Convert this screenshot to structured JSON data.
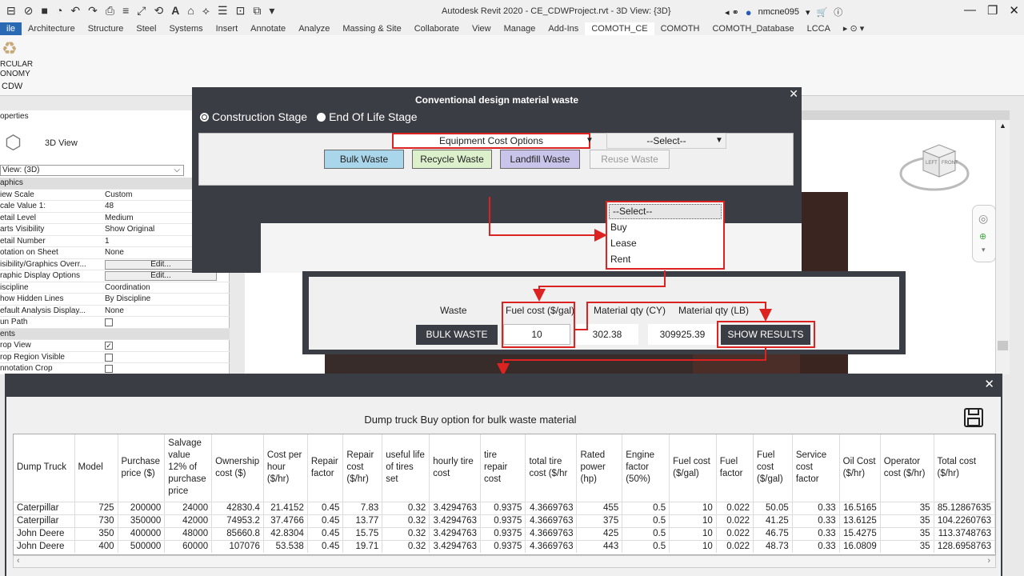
{
  "app": {
    "title": "Autodesk Revit 2020 - CE_CDWProject.rvt - 3D View: {3D}",
    "user": "nmcne095",
    "quick_access": [
      "new-icon",
      "open-icon",
      "save-icon",
      "undo-icon",
      "redo-icon",
      "print-icon",
      "measure-icon",
      "text-icon"
    ],
    "help": "?"
  },
  "ribbon": {
    "tabs": [
      "ile",
      "Architecture",
      "Structure",
      "Steel",
      "Systems",
      "Insert",
      "Annotate",
      "Analyze",
      "Massing & Site",
      "Collaborate",
      "View",
      "Manage",
      "Add-Ins",
      "COMOTH_CE",
      "COMOTH",
      "COMOTH_Database",
      "LCCA"
    ],
    "active_tab": "COMOTH_CE",
    "panel_label_line1": "RCULAR",
    "panel_label_line2": "ONOMY",
    "panel_label_cdw": "CDW"
  },
  "properties": {
    "title": "operties",
    "type_label": "3D View",
    "selector": "View: (3D)",
    "rows": [
      {
        "k": "aphics",
        "v": "",
        "group": true
      },
      {
        "k": "iew Scale",
        "v": "Custom"
      },
      {
        "k": "cale Value    1:",
        "v": "48"
      },
      {
        "k": "etail Level",
        "v": "Medium"
      },
      {
        "k": "arts Visibility",
        "v": "Show Original"
      },
      {
        "k": "etail Number",
        "v": "1"
      },
      {
        "k": "otation on Sheet",
        "v": "None"
      },
      {
        "k": "isibility/Graphics Overr...",
        "v": "Edit...",
        "button": true
      },
      {
        "k": "raphic Display Options",
        "v": "Edit...",
        "button": true
      },
      {
        "k": "iscipline",
        "v": "Coordination"
      },
      {
        "k": "how Hidden Lines",
        "v": "By Discipline"
      },
      {
        "k": "efault Analysis Display...",
        "v": "None"
      },
      {
        "k": "un Path",
        "v": "",
        "checkbox": "off"
      },
      {
        "k": "ents",
        "v": "",
        "group": true
      },
      {
        "k": "rop View",
        "v": "",
        "checkbox": "on"
      },
      {
        "k": "rop Region Visible",
        "v": "",
        "checkbox": "off"
      },
      {
        "k": "nnotation Crop",
        "v": "",
        "checkbox": "off"
      }
    ]
  },
  "viewcube": {
    "left": "LEFT",
    "front": "FRONT"
  },
  "dialog1": {
    "title": "Conventional design material waste",
    "stage_options": [
      "Construction Stage",
      "End Of Life Stage"
    ],
    "selected_stage": "Construction Stage",
    "waste_buttons": [
      "Bulk Waste",
      "Recycle Waste",
      "Landfill Waste",
      "Reuse Waste"
    ],
    "equipment_select": "Equipment Cost Options",
    "option_select": "--Select--",
    "dropdown_options": [
      "--Select--",
      "Buy",
      "Lease",
      "Rent"
    ]
  },
  "dialog2": {
    "waste_label": "Waste",
    "fuel_label": "Fuel cost ($/gal)",
    "cy_label": "Material qty (CY)",
    "lb_label": "Material qty (LB)",
    "waste_button": "BULK WASTE",
    "fuel_value": "10",
    "cy_value": "302.38",
    "lb_value": "309925.39",
    "show_button": "SHOW RESULTS"
  },
  "results": {
    "title": "Dump truck Buy option for bulk waste material",
    "headers": [
      "Dump Truck",
      "Model",
      "Purchase price ($)",
      "Salvage value 12% of purchase price",
      "Ownership cost ($)",
      "Cost per hour ($/hr)",
      "Repair factor",
      "Repair cost ($/hr)",
      "useful life of tires set",
      "hourly tire cost",
      "tire repair cost",
      "total tire cost ($/hr",
      "Rated power (hp)",
      "Engine factor (50%)",
      "Fuel cost ($/gal)",
      "Fuel factor",
      "Fuel cost ($/gal)",
      "Service cost factor",
      "Oil Cost ($/hr)",
      "Operator cost ($/hr)",
      "Total cost ($/hr)"
    ],
    "rows": [
      [
        "Caterpillar",
        "725",
        "200000",
        "24000",
        "42830.4",
        "21.4152",
        "0.45",
        "7.83",
        "0.32",
        "3.4294763",
        "0.9375",
        "4.3669763",
        "455",
        "0.5",
        "10",
        "0.022",
        "50.05",
        "0.33",
        "16.5165",
        "35",
        "85.12867635"
      ],
      [
        "Caterpillar",
        "730",
        "350000",
        "42000",
        "74953.2",
        "37.4766",
        "0.45",
        "13.77",
        "0.32",
        "3.4294763",
        "0.9375",
        "4.3669763",
        "375",
        "0.5",
        "10",
        "0.022",
        "41.25",
        "0.33",
        "13.6125",
        "35",
        "104.2260763"
      ],
      [
        "John Deere",
        "350",
        "400000",
        "48000",
        "85660.8",
        "42.8304",
        "0.45",
        "15.75",
        "0.32",
        "3.4294763",
        "0.9375",
        "4.3669763",
        "425",
        "0.5",
        "10",
        "0.022",
        "46.75",
        "0.33",
        "15.4275",
        "35",
        "113.3748763"
      ],
      [
        "John Deere",
        "400",
        "500000",
        "60000",
        "107076",
        "53.538",
        "0.45",
        "19.71",
        "0.32",
        "3.4294763",
        "0.9375",
        "4.3669763",
        "443",
        "0.5",
        "10",
        "0.022",
        "48.73",
        "0.33",
        "16.0809",
        "35",
        "128.6958763"
      ]
    ]
  },
  "colors": {
    "dialog_bg": "#3b3d44",
    "annotation_red": "#dd2222",
    "bulk_btn": "#a9d6ea",
    "recycle_btn": "#dcf0cc",
    "landfill_btn": "#c9c4ea",
    "file_tab": "#2a6ab4"
  }
}
